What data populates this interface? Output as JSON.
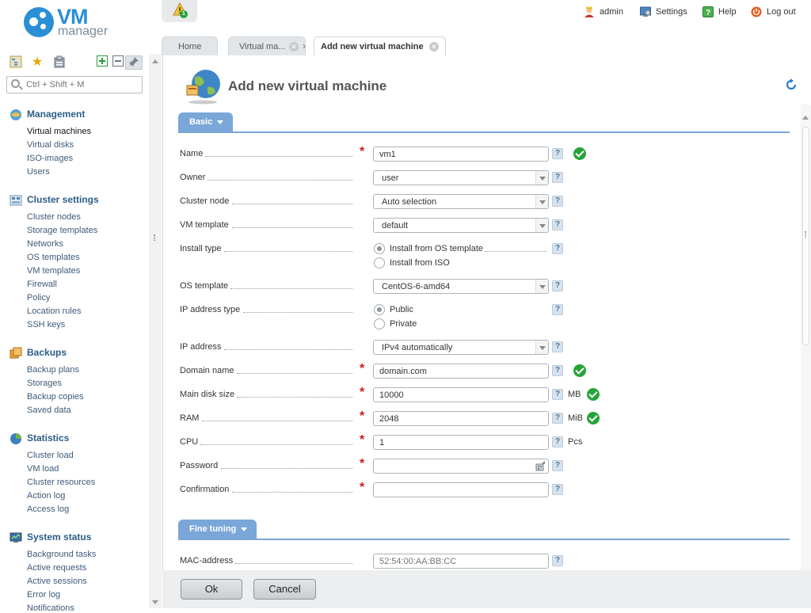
{
  "logo": {
    "text_big": "VM",
    "text_small": "manager"
  },
  "header": {
    "notifications_count": "1",
    "user_label": "admin",
    "settings_label": "Settings",
    "help_label": "Help",
    "logout_label": "Log out"
  },
  "sidebar": {
    "search_placeholder": "Ctrl + Shift + M",
    "sections": [
      {
        "title": "Management",
        "items": [
          "Virtual machines",
          "Virtual disks",
          "ISO-images",
          "Users"
        ]
      },
      {
        "title": "Cluster settings",
        "items": [
          "Cluster nodes",
          "Storage templates",
          "Networks",
          "OS templates",
          "VM templates",
          "Firewall",
          "Policy",
          "Location rules",
          "SSH keys"
        ]
      },
      {
        "title": "Backups",
        "items": [
          "Backup plans",
          "Storages",
          "Backup copies",
          "Saved data"
        ]
      },
      {
        "title": "Statistics",
        "items": [
          "Cluster load",
          "VM load",
          "Cluster resources",
          "Action log",
          "Access log"
        ]
      },
      {
        "title": "System status",
        "items": [
          "Background tasks",
          "Active requests",
          "Active sessions",
          "Error log",
          "Notifications"
        ]
      }
    ]
  },
  "tabs": [
    {
      "label": "Home"
    },
    {
      "label": "Virtual ma..."
    },
    {
      "label": "Add new virtual machine"
    }
  ],
  "page": {
    "title": "Add new virtual machine"
  },
  "form": {
    "basic_label": "Basic",
    "fine_tuning_label": "Fine tuning",
    "fields": {
      "name": {
        "label": "Name",
        "value": "vm1"
      },
      "owner": {
        "label": "Owner",
        "value": "user"
      },
      "cluster_node": {
        "label": "Cluster node",
        "value": "Auto selection"
      },
      "vm_template": {
        "label": "VM template",
        "value": "default"
      },
      "install_type": {
        "label": "Install type",
        "options": [
          "Install from OS template",
          "Install from ISO"
        ],
        "selected": "Install from OS template"
      },
      "os_template": {
        "label": "OS template",
        "value": "CentOS-6-amd64"
      },
      "ip_address_type": {
        "label": "IP address type",
        "options": [
          "Public",
          "Private"
        ],
        "selected": "Public"
      },
      "ip_address": {
        "label": "IP address",
        "value": "IPv4 automatically"
      },
      "domain_name": {
        "label": "Domain name",
        "value": "domain.com"
      },
      "main_disk_size": {
        "label": "Main disk size",
        "value": "10000",
        "unit": "MB"
      },
      "ram": {
        "label": "RAM",
        "value": "2048",
        "unit": "MiB"
      },
      "cpu": {
        "label": "CPU",
        "value": "1",
        "unit": "Pcs"
      },
      "password": {
        "label": "Password",
        "value": ""
      },
      "confirmation": {
        "label": "Confirmation",
        "value": ""
      },
      "mac_address": {
        "label": "MAC-address",
        "value": "52:54:00:AA:BB:CC"
      }
    }
  },
  "footer": {
    "ok_label": "Ok",
    "cancel_label": "Cancel"
  },
  "colors": {
    "accent": "#2a8fd6",
    "band": "#7aa7d8",
    "required": "#cc1c1c",
    "valid": "#26a43b"
  }
}
